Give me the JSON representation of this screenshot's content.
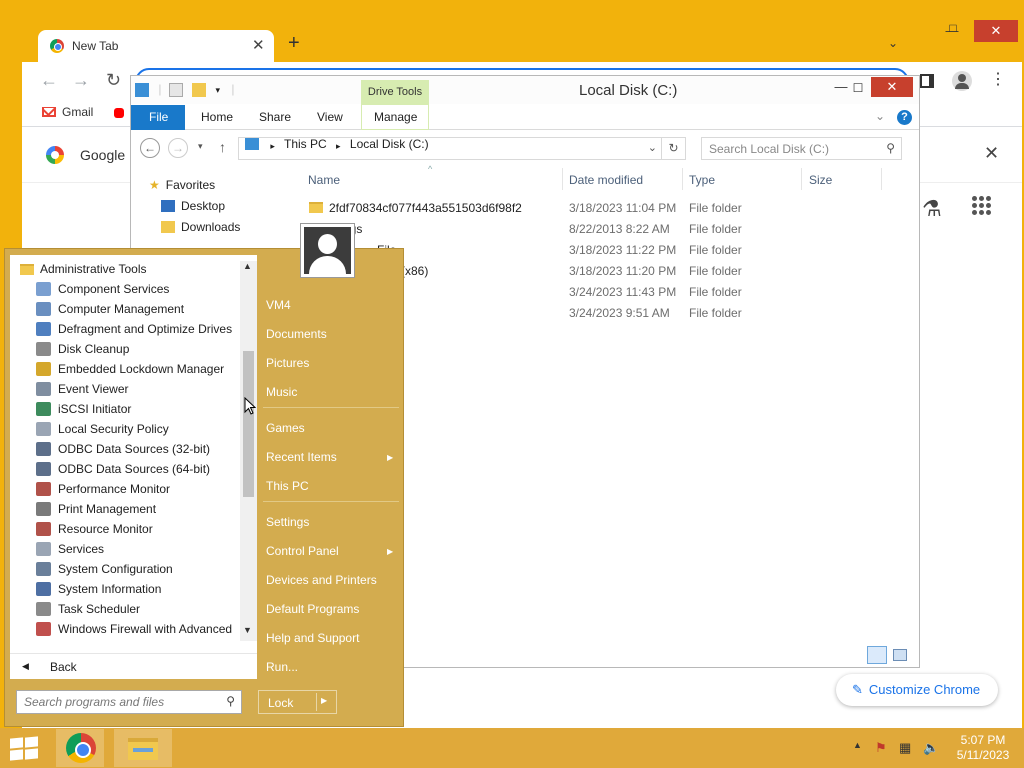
{
  "chrome": {
    "tab_title": "New Tab",
    "tab_close": "✕",
    "new_tab": "+",
    "tab_search": "⌄",
    "win_min": "—",
    "win_max": "☐",
    "win_close": "✕",
    "nav_back": "←",
    "nav_forward": "→",
    "bookmarks": [
      {
        "label": "Gmail"
      }
    ],
    "gbar_text": "Google",
    "gbar_close": "✕",
    "customize_label": "Customize Chrome",
    "accent": "#1a73e8"
  },
  "explorer": {
    "title": "Local Disk (C:)",
    "contextual_tab": "Drive Tools",
    "ribbon_tabs": [
      "File",
      "Home",
      "Share",
      "View",
      "Manage"
    ],
    "help": "?",
    "breadcrumb": [
      "This PC",
      "Local Disk (C:)"
    ],
    "search_placeholder": "Search Local Disk (C:)",
    "nav_items": [
      {
        "label": "Favorites"
      },
      {
        "label": "Desktop"
      },
      {
        "label": "Downloads"
      }
    ],
    "columns": [
      "Name",
      "Date modified",
      "Type",
      "Size"
    ],
    "rows": [
      {
        "name": "2fdf70834cf077f443a551503d6f98f2",
        "date": "3/18/2023 11:04 PM",
        "type": "File folder"
      },
      {
        "name": "ogs",
        "date": "8/22/2013 8:22 AM",
        "type": "File folder"
      },
      {
        "name": "File",
        "date": "3/18/2023 11:22 PM",
        "type": "File folder"
      },
      {
        "name": "(x86)",
        "date": "3/18/2023 11:20 PM",
        "type": "File folder"
      },
      {
        "name": "",
        "date": "3/24/2023 11:43 PM",
        "type": "File folder"
      },
      {
        "name": "",
        "date": "3/24/2023 9:51 AM",
        "type": "File folder"
      }
    ]
  },
  "startmenu": {
    "folder_label": "Administrative Tools",
    "programs": [
      {
        "label": "Component Services",
        "color": "#7a9fd0"
      },
      {
        "label": "Computer Management",
        "color": "#6a8fc0"
      },
      {
        "label": "Defragment and Optimize Drives",
        "color": "#4f7fbf"
      },
      {
        "label": "Disk Cleanup",
        "color": "#8a8a8a"
      },
      {
        "label": "Embedded Lockdown Manager",
        "color": "#d4a72c"
      },
      {
        "label": "Event Viewer",
        "color": "#7f8ea0"
      },
      {
        "label": "iSCSI Initiator",
        "color": "#3d8b5d"
      },
      {
        "label": "Local Security Policy",
        "color": "#9aa5b4"
      },
      {
        "label": "ODBC Data Sources (32-bit)",
        "color": "#5d6f8a"
      },
      {
        "label": "ODBC Data Sources (64-bit)",
        "color": "#5d6f8a"
      },
      {
        "label": "Performance Monitor",
        "color": "#b0524a"
      },
      {
        "label": "Print Management",
        "color": "#7a7a7a"
      },
      {
        "label": "Resource Monitor",
        "color": "#b0524a"
      },
      {
        "label": "Services",
        "color": "#9aa5b4"
      },
      {
        "label": "System Configuration",
        "color": "#6a7f9a"
      },
      {
        "label": "System Information",
        "color": "#4e6fa3"
      },
      {
        "label": "Task Scheduler",
        "color": "#8a8a8a"
      },
      {
        "label": "Windows Firewall with Advanced",
        "color": "#c0504d"
      }
    ],
    "back_label": "Back",
    "search_placeholder": "Search programs and files",
    "right_links": [
      {
        "label": "VM4"
      },
      {
        "label": "Documents"
      },
      {
        "label": "Pictures"
      },
      {
        "label": "Music"
      },
      {
        "label": "Games"
      },
      {
        "label": "Recent Items"
      },
      {
        "label": "This PC"
      },
      {
        "label": "Settings"
      },
      {
        "label": "Control Panel"
      },
      {
        "label": "Devices and Printers"
      },
      {
        "label": "Default Programs"
      },
      {
        "label": "Help and Support"
      },
      {
        "label": "Run..."
      }
    ],
    "lock_label": "Lock"
  },
  "taskbar": {
    "time": "5:07 PM",
    "date": "5/11/2023"
  }
}
